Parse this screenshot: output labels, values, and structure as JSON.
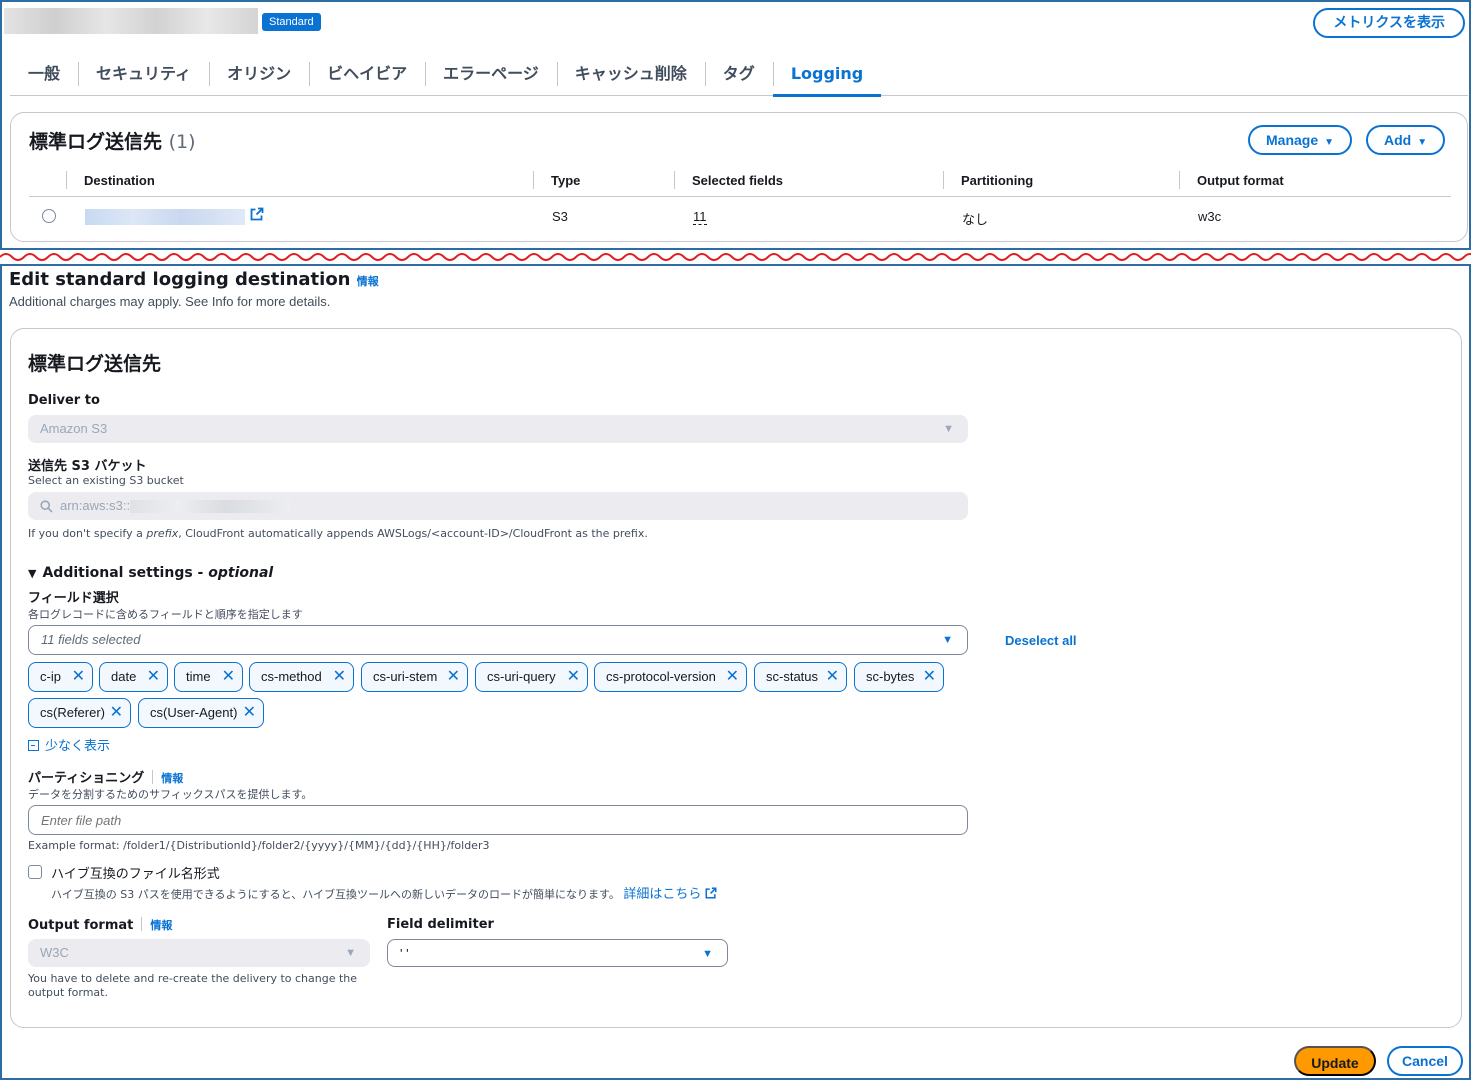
{
  "header": {
    "badge": "Standard",
    "metrics_button": "メトリクスを表示"
  },
  "tabs": [
    {
      "label": "一般"
    },
    {
      "label": "セキュリティ"
    },
    {
      "label": "オリジン"
    },
    {
      "label": "ビヘイビア"
    },
    {
      "label": "エラーページ"
    },
    {
      "label": "キャッシュ削除"
    },
    {
      "label": "タグ"
    },
    {
      "label": "Logging",
      "active": true
    }
  ],
  "log_destinations": {
    "title": "標準ログ送信先",
    "count": "(1)",
    "manage_button": "Manage",
    "add_button": "Add",
    "columns": [
      "Destination",
      "Type",
      "Selected fields",
      "Partitioning",
      "Output format"
    ],
    "rows": [
      {
        "type": "S3",
        "selected_fields": "11",
        "partitioning": "なし",
        "output_format": "w3c"
      }
    ]
  },
  "edit": {
    "title": "Edit standard logging destination",
    "info": "情報",
    "subtitle": "Additional charges may apply. See Info for more details.",
    "card_title": "標準ログ送信先",
    "deliver_to": {
      "label": "Deliver to",
      "value": "Amazon S3"
    },
    "bucket": {
      "label": "送信先 S3 バケット",
      "description": "Select an existing S3 bucket",
      "value": "arn:aws:s3:::",
      "hint_pre": "If you don't specify a ",
      "hint_em": "prefix",
      "hint_post": ", CloudFront automatically appends AWSLogs/<account-ID>/CloudFront as the prefix."
    },
    "additional": {
      "label": "Additional settings - ",
      "optional": "optional"
    },
    "fields": {
      "label": "フィールド選択",
      "description": "各ログレコードに含めるフィールドと順序を指定します",
      "selected": "11 fields selected",
      "deselect_all": "Deselect all",
      "tokens": [
        "c-ip",
        "date",
        "time",
        "cs-method",
        "cs-uri-stem",
        "cs-uri-query",
        "cs-protocol-version",
        "sc-status",
        "sc-bytes",
        "cs(Referer)",
        "cs(User-Agent)"
      ],
      "show_less": "少なく表示"
    },
    "partitioning": {
      "label": "パーティショニング",
      "info": "情報",
      "description": "データを分割するためのサフィックスパスを提供します。",
      "placeholder": "Enter file path",
      "example": "Example format: /folder1/{DistributionId}/folder2/{yyyy}/{MM}/{dd}/{HH}/folder3"
    },
    "hive": {
      "label": "ハイブ互換のファイル名形式",
      "description": "ハイブ互換の S3 パスを使用できるようにすると、ハイブ互換ツールへの新しいデータのロードが簡単になります。",
      "link": "詳細はこちら"
    },
    "output_format": {
      "label": "Output format",
      "info": "情報",
      "value": "W3C",
      "hint": "You have to delete and re-create the delivery to change the output format."
    },
    "field_delimiter": {
      "label": "Field delimiter",
      "value": "' '"
    },
    "update_button": "Update",
    "cancel_button": "Cancel"
  }
}
